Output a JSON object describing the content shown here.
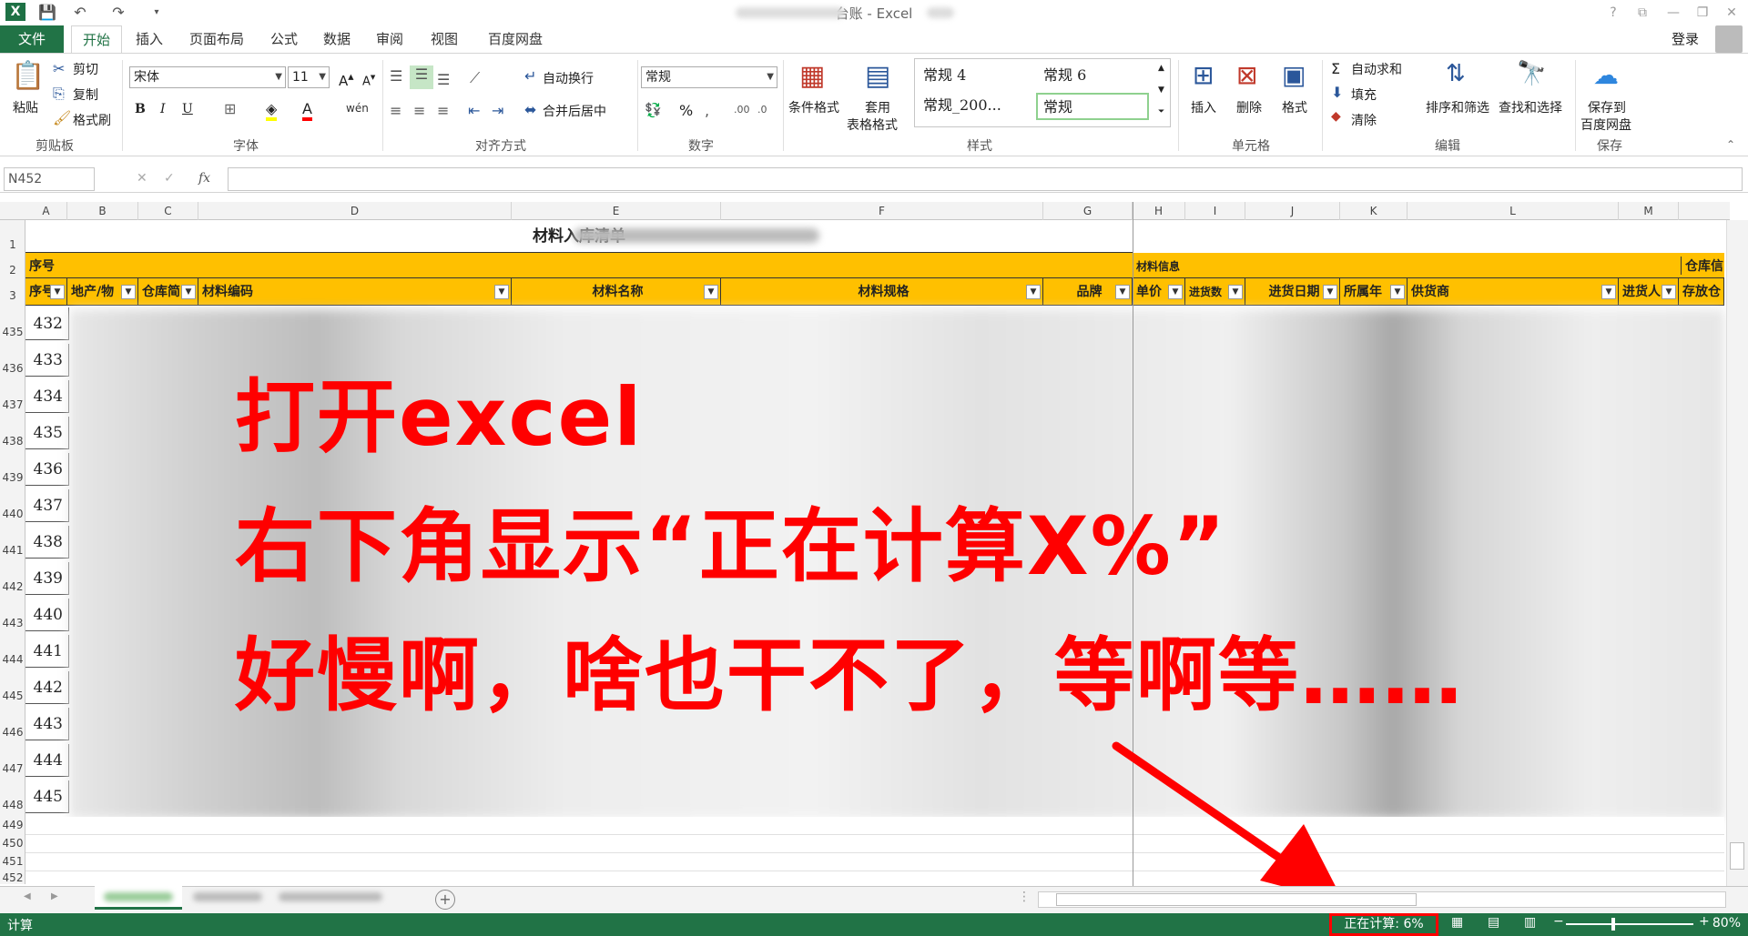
{
  "window": {
    "title": "台账 - Excel",
    "help": "?",
    "login": "登录"
  },
  "ribbon_tabs": [
    "文件",
    "开始",
    "插入",
    "页面布局",
    "公式",
    "数据",
    "审阅",
    "视图",
    "百度网盘"
  ],
  "clipboard": {
    "paste": "粘贴",
    "cut": "剪切",
    "copy": "复制",
    "painter": "格式刷",
    "label": "剪贴板"
  },
  "font": {
    "name": "宋体",
    "size": "11",
    "bold": "B",
    "italic": "I",
    "underline": "U",
    "label": "字体"
  },
  "alignment": {
    "wrap": "自动换行",
    "merge": "合并后居中",
    "label": "对齐方式"
  },
  "number": {
    "format": "常规",
    "percent": "%",
    "label": "数字"
  },
  "styles": {
    "conditional": "条件格式",
    "table_fmt_1": "套用",
    "table_fmt_2": "表格格式",
    "cells": [
      "常规 4",
      "常规 6",
      "常规_200...",
      "常规"
    ],
    "label": "样式"
  },
  "cells_group": {
    "insert": "插入",
    "delete": "删除",
    "format": "格式",
    "label": "单元格"
  },
  "editing": {
    "autosum": "自动求和",
    "fill": "填充",
    "clear": "清除",
    "sort": "排序和筛选",
    "find": "查找和选择",
    "label": "编辑"
  },
  "save_group": {
    "save1": "保存到",
    "save2": "百度网盘",
    "label": "保存"
  },
  "formula_bar": {
    "name_box": "N452",
    "fx": "fx",
    "value": ""
  },
  "columns": [
    "A",
    "B",
    "C",
    "D",
    "E",
    "F",
    "G",
    "H",
    "I",
    "J",
    "K",
    "L",
    "M"
  ],
  "sheet_title": "材料入库清单",
  "header_row2": {
    "seq": "序号",
    "material_info": "材料信息",
    "warehouse_info": "仓库信"
  },
  "header_row3": [
    "序号",
    "地产/物",
    "仓库简",
    "材料编码",
    "材料名称",
    "材料规格",
    "品牌",
    "单价",
    "进货数",
    "进货日期",
    "所属年",
    "供货商",
    "进货人",
    "存放仓"
  ],
  "row_numbers": [
    "1",
    "2",
    "3",
    "435",
    "436",
    "437",
    "438",
    "439",
    "440",
    "441",
    "442",
    "443",
    "444",
    "445",
    "446",
    "447",
    "448",
    "449",
    "450",
    "451",
    "452"
  ],
  "seq_values": [
    "432",
    "433",
    "434",
    "435",
    "436",
    "437",
    "438",
    "439",
    "440",
    "441",
    "442",
    "443",
    "444",
    "445"
  ],
  "overlay": {
    "line1": "打开excel",
    "line2": "右下角显示“正在计算X%”",
    "line3": "好慢啊，啥也干不了，等啊等……"
  },
  "status": {
    "left": "计算",
    "calculating": "正在计算: 6%",
    "zoom": "80%"
  },
  "colors": {
    "excel_green": "#217346",
    "header_fill": "#ffc000",
    "annotation_red": "#ff0000"
  }
}
